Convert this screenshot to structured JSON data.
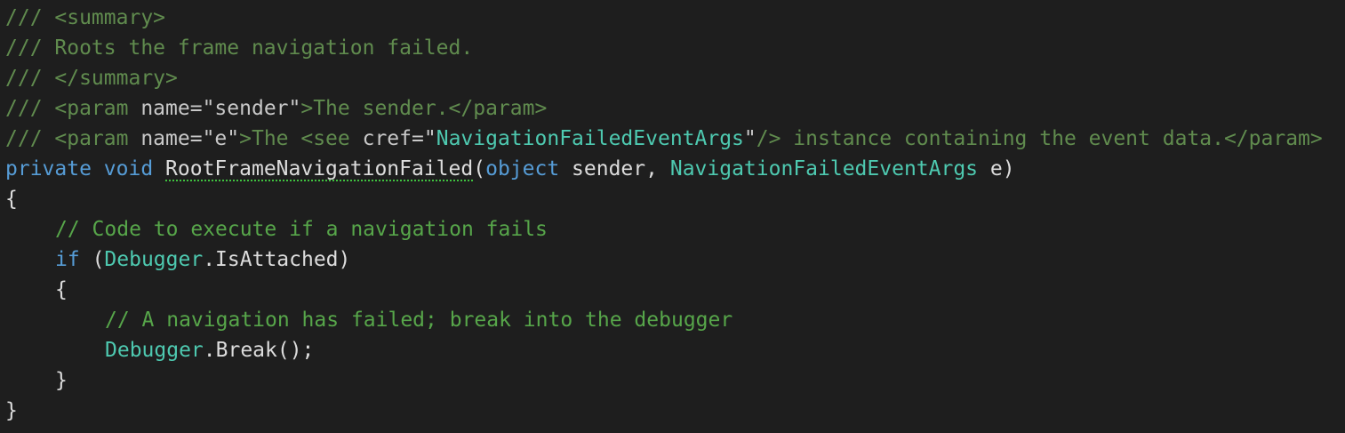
{
  "lines": [
    {
      "doc": "/// <summary>"
    },
    {
      "doc": "/// Roots the frame navigation failed."
    },
    {
      "doc": "/// </summary>"
    },
    {
      "p1": "/// <param ",
      "attr": "name=",
      "val": "\"sender\"",
      "p2": ">The sender.</param>"
    },
    {
      "p1": "/// <param ",
      "attr": "name=",
      "val": "\"e\"",
      "p2": ">The <see ",
      "attr2": "cref=",
      "q1": "\"",
      "ref": "NavigationFailedEventArgs",
      "q2": "\"",
      "p3": "/> instance containing the event data.</param>"
    },
    {
      "kw1": "private",
      "kw2": "void",
      "method": "RootFrameNavigationFailed",
      "open": "(",
      "kw3": "object",
      "p1name": "sender,",
      "type": "NavigationFailedEventArgs",
      "p2name": "e)"
    },
    {
      "text": "{"
    },
    {
      "comment": "// Code to execute if a navigation fails"
    },
    {
      "kw": "if",
      "open": "(",
      "type": "Debugger",
      "member": ".IsAttached)"
    },
    {
      "text": "{"
    },
    {
      "comment": "// A navigation has failed; break into the debugger"
    },
    {
      "type": "Debugger",
      "call": ".Break();"
    },
    {
      "text": "}"
    },
    {
      "text": "}"
    }
  ]
}
